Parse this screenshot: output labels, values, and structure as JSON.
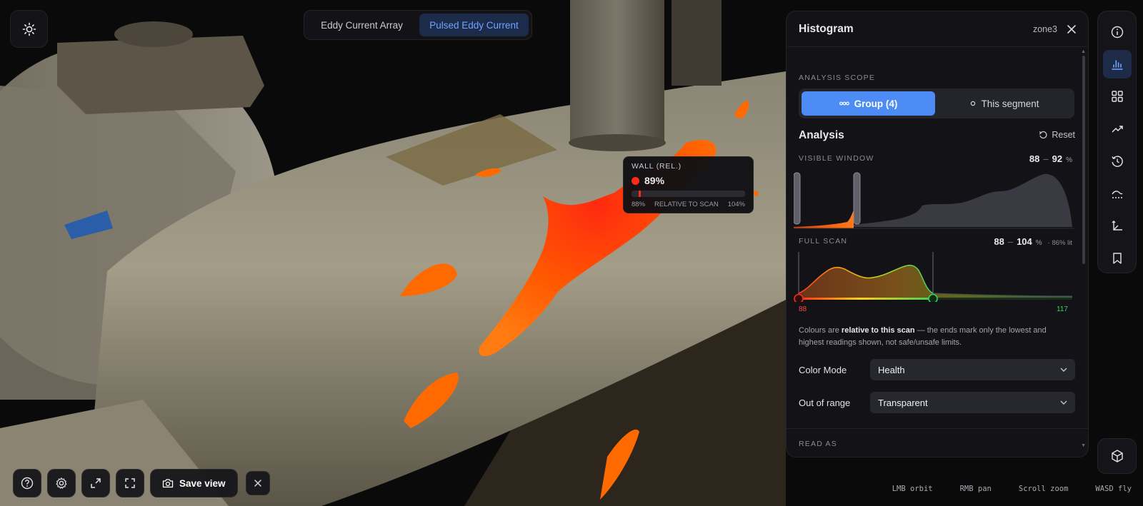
{
  "mode_toggle": {
    "options": [
      "Eddy Current Array",
      "Pulsed Eddy Current"
    ],
    "active_index": 1
  },
  "tooltip": {
    "label": "WALL (REL.)",
    "value": "89%",
    "scale_min": "88%",
    "scale_mid": "RELATIVE TO SCAN",
    "scale_max": "104%",
    "marker_fraction": 0.06
  },
  "panel": {
    "title": "Histogram",
    "zone": "zone3",
    "scope_label": "ANALYSIS SCOPE",
    "scope_options": [
      "Group (4)",
      "This segment"
    ],
    "scope_active_index": 0,
    "analysis_title": "Analysis",
    "reset_label": "Reset",
    "visible_window": {
      "label": "VISIBLE WINDOW",
      "min": "88",
      "max": "92",
      "unit": "%"
    },
    "full_scan": {
      "label": "FULL SCAN",
      "min": "88",
      "max": "104",
      "unit": "%",
      "extra": "· 86% lit",
      "scale_min": "88",
      "scale_max": "117"
    },
    "info_text_pre": "Colours are ",
    "info_text_bold": "relative to this scan",
    "info_text_post": " — the ends mark only the lowest and highest readings shown, not safe/unsafe limits.",
    "color_mode": {
      "label": "Color Mode",
      "value": "Health"
    },
    "out_of_range": {
      "label": "Out of range",
      "value": "Transparent"
    },
    "read_as_label": "READ AS"
  },
  "toolbar": {
    "tools": [
      "info-icon",
      "histogram-icon",
      "grid-icon",
      "trend-icon",
      "history-icon",
      "profile-icon",
      "axes-icon",
      "bookmark-icon"
    ],
    "active_index": 1
  },
  "bottom_bar": {
    "save_view_label": "Save view"
  },
  "hints": [
    "LMB orbit",
    "RMB pan",
    "Scroll zoom",
    "WASD fly"
  ],
  "colors": {
    "accent": "#4d8cf5",
    "low": "#ff2a17",
    "mid": "#ffd21a",
    "high": "#3ecf5c",
    "overlay": "#ff6a00"
  }
}
